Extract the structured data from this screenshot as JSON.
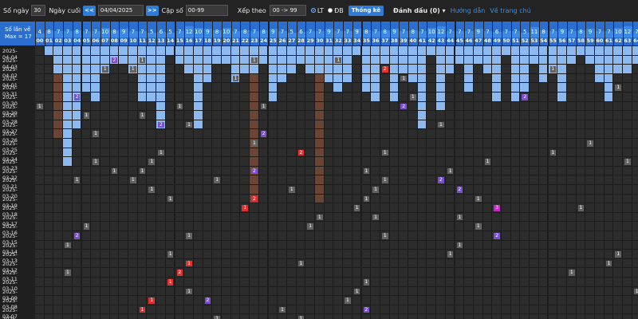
{
  "toolbar": {
    "days_label": "Số ngày",
    "days_value": "30",
    "last_day_label": "Ngày cuối",
    "prev_button": "<<",
    "date_value": "04/04/2025",
    "next_button": ">>",
    "pair_label": "Cặp số",
    "pair_value": "00-99",
    "sort_label": "Xếp theo",
    "sort_value": "00 -> 99",
    "radio_lt": "LT",
    "radio_db": "ĐB",
    "stats_button": "Thống kê",
    "mark_label": "Đánh dấu (0)",
    "guide_link": "Hướng dẫn",
    "home_link": "Về trang chủ"
  },
  "header": {
    "title_line1": "Số lần về",
    "title_line2": "Max = 17"
  },
  "columns": [
    "00",
    "01",
    "02",
    "03",
    "04",
    "05",
    "06",
    "07",
    "08",
    "09",
    "10",
    "11",
    "12",
    "13",
    "14",
    "15",
    "16",
    "17",
    "18",
    "19",
    "20",
    "21",
    "22",
    "23",
    "24",
    "25",
    "26",
    "27",
    "28",
    "29",
    "30",
    "31",
    "32",
    "33",
    "34",
    "35",
    "36",
    "37",
    "38",
    "39",
    "40",
    "41",
    "42",
    "43",
    "44",
    "45",
    "46",
    "47",
    "48",
    "49",
    "50",
    "51",
    "52",
    "53",
    "54",
    "55",
    "56",
    "57",
    "58",
    "59",
    "60",
    "61",
    "62",
    "63",
    "64",
    "65"
  ],
  "counts": [
    4,
    8,
    7,
    7,
    8,
    7,
    7,
    10,
    8,
    9,
    7,
    7,
    5,
    6,
    5,
    7,
    12,
    10,
    9,
    8,
    10,
    7,
    8,
    7,
    8,
    9,
    7,
    5,
    6,
    7,
    7,
    9,
    7,
    7,
    9,
    8,
    7,
    8,
    9,
    7,
    8,
    7,
    10,
    12,
    7,
    7,
    7,
    9,
    7,
    6,
    7,
    7,
    5,
    11,
    8,
    7,
    9,
    7,
    8,
    9,
    7,
    7,
    10,
    12,
    7,
    7
  ],
  "dates": [
    "2025-04-04",
    "2025-04-03",
    "2025-04-02",
    "2025-04-01",
    "2025-03-31",
    "2025-03-30",
    "2025-03-29",
    "2025-03-28",
    "2025-03-27",
    "2025-03-26",
    "2025-03-25",
    "2025-03-24",
    "2025-03-23",
    "2025-03-22",
    "2025-03-21",
    "2025-03-20",
    "2025-03-19",
    "2025-03-18",
    "2025-03-17",
    "2025-03-16",
    "2025-03-15",
    "2025-03-14",
    "2025-03-13",
    "2025-03-12",
    "2025-03-11",
    "2025-03-10",
    "2025-03-09",
    "2025-03-08",
    "2025-03-07",
    "2025-03-06"
  ],
  "gaps": [
    0,
    1,
    10,
    13,
    9,
    5,
    6,
    3,
    2,
    2,
    3,
    6,
    6,
    9,
    1,
    2,
    3,
    9,
    4,
    2,
    2,
    4,
    3,
    17,
    2,
    6,
    4,
    3,
    2,
    3,
    17,
    4,
    5,
    4,
    1,
    5,
    6,
    2,
    6,
    3,
    4,
    9,
    1,
    7,
    3,
    2,
    5,
    2,
    3,
    6,
    1,
    6,
    5,
    2,
    4,
    3,
    6,
    2,
    1,
    2,
    4,
    6,
    3,
    3,
    2,
    2
  ],
  "values": {
    "1": {
      "1": "2",
      "2": "1",
      "6": "1",
      "9": "1"
    },
    "2": {
      "0": "1",
      "9": "2",
      "15": "1",
      "21": "1"
    },
    "3": {
      "2": "1",
      "8": "1"
    },
    "4": {
      "14": "1",
      "15": "1"
    },
    "5": {
      "5": "1",
      "9": "2",
      "15": "2"
    },
    "6": {
      "3": "2",
      "12": "1",
      "17": "1",
      "20": "1"
    },
    "7": {
      "10": "2",
      "12": "1",
      "14": "1"
    },
    "8": {
      "1": "1",
      "13": "2",
      "14": "1"
    },
    "9": {
      "9": "1",
      "15": "2"
    },
    "10": {
      "3": "1",
      "5": "1",
      "13": "1"
    },
    "11": {
      "0": "1",
      "8": "1",
      "13": "2",
      "16": "1"
    },
    "12": {
      "1": "1",
      "4": "1",
      "6": "1",
      "18": "1"
    },
    "13": {
      "3": "1",
      "4": "1",
      "8": "2",
      "12": "1",
      "15": "1"
    },
    "14": {
      "0": "1",
      "2": "1",
      "5": "1",
      "11": "1",
      "13": "2"
    },
    "15": {
      "1": "1",
      "6": "1",
      "9": "1",
      "12": "2"
    },
    "16": {
      "0": "1",
      "3": "2",
      "7": "1",
      "11": "1"
    },
    "17": {
      "1": "1",
      "5": "1",
      "10": "3",
      "13": "1"
    },
    "18": {
      "2": "1",
      "4": "1",
      "7": "1"
    },
    "19": {
      "0": "1",
      "6": "1",
      "14": "1"
    },
    "20": {
      "1": "1",
      "5": "2",
      "12": "2",
      "16": "1"
    },
    "21": {
      "2": "1",
      "10": "1"
    },
    "22": {
      "0": "1",
      "6": "1",
      "12": "1"
    },
    "23": {
      "4": "1",
      "11": "1",
      "15": "1"
    },
    "24": {
      "1": "1",
      "5": "1",
      "9": "2"
    },
    "25": {
      "2": "1",
      "7": "1",
      "14": "1"
    },
    "26": {
      "0": "1",
      "6": "1",
      "12": "1"
    },
    "27": {
      "3": "1",
      "5": "2",
      "10": "1"
    },
    "28": {
      "1": "1",
      "6": "1",
      "9": "2"
    },
    "29": {
      "2": "1",
      "5": "1"
    }
  },
  "colors": {
    "blue": "#8bb9f0",
    "brown": "#6b4433",
    "gray": "#626262",
    "red": "#e03030",
    "purple": "#7b4fd0",
    "magenta": "#c12bc4",
    "header": "#2a6fd0"
  }
}
